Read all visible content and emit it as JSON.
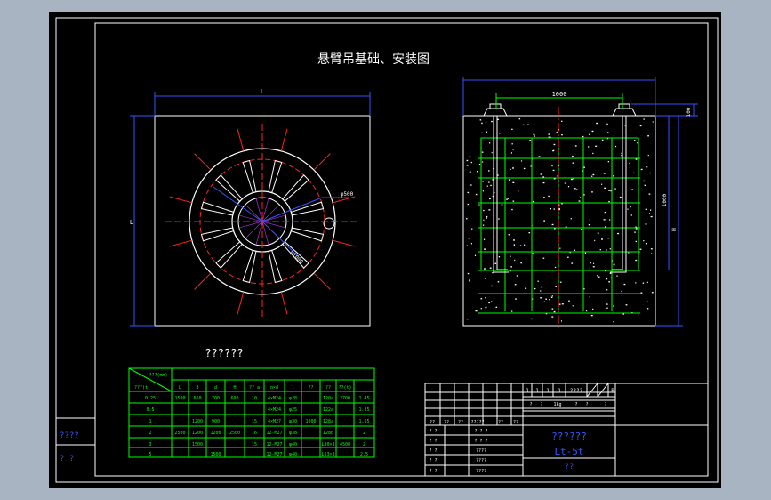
{
  "drawing_title": "悬臂吊基础、安装图",
  "table_title": "??????",
  "dimension_labels": {
    "top_width": "L",
    "left_height": "L",
    "bolt_circle": "φ500",
    "circle_dim": "φ1000",
    "section_width": "1000",
    "section_top_offset": "100",
    "section_height_a": "1000",
    "section_height_b": "H"
  },
  "spec_table": {
    "diag_top": "???(mm)",
    "diag_bottom": "???(t)",
    "headers": [
      "L",
      "B",
      "d",
      "H",
      "?? a",
      "n×d",
      "l",
      "??",
      "??",
      "??(t)"
    ],
    "loads": [
      "0.25",
      "0.5",
      "1",
      "2",
      "3",
      "5"
    ],
    "cells": [
      "1500",
      "660",
      "700",
      "600",
      "10",
      "4×M24",
      "",
      "",
      "",
      "1000",
      "900",
      "15",
      "4×M27",
      "",
      "",
      "",
      "2500",
      "1200",
      "1200",
      "2500",
      "16",
      "12-M27",
      "1000",
      "",
      "",
      "1500",
      "1500",
      "",
      "15",
      "",
      "",
      "",
      "",
      "",
      "φ28",
      "φ25",
      "φ30",
      "φ38",
      "φ40",
      "φ40",
      "I20a",
      "I22a",
      "I28a",
      "I28b",
      "L80×8",
      "L63×8",
      "2700",
      "4500",
      "1.45",
      "1.35",
      "1.65",
      "2",
      "2.5"
    ]
  },
  "spec_rows": [
    [
      "0.25",
      "1500",
      "660",
      "700",
      "600",
      "10",
      "4×M24",
      "φ28",
      "",
      "I20a",
      "2700",
      "1.45"
    ],
    [
      "0.5",
      "",
      "",
      "",
      "",
      "",
      "4×M24",
      "φ25",
      "",
      "I22a",
      "",
      "1.35"
    ],
    [
      "1",
      "",
      "1200",
      "900",
      "",
      "15",
      "4×M27",
      "φ30",
      "1000",
      "I28a",
      "",
      "1.65"
    ],
    [
      "2",
      "2500",
      "1200",
      "1200",
      "2500",
      "16",
      "12-M27",
      "φ38",
      "",
      "I28b",
      "",
      "2"
    ],
    [
      "3",
      "",
      "1500",
      "",
      "",
      "15",
      "12-M27",
      "φ40",
      "",
      "L80×8",
      "4500",
      "2"
    ],
    [
      "5",
      "",
      "",
      "1500",
      "",
      "",
      "12-M27",
      "φ40",
      "",
      "L63×8",
      "",
      "2.5"
    ]
  ],
  "title_block": {
    "row1": [
      "1",
      "1",
      "1",
      "1",
      "????",
      "",
      "B"
    ],
    "row2": [
      "?",
      "?",
      "1kg",
      "?",
      "?",
      "?"
    ],
    "row3": [
      "??",
      "??",
      "??",
      "?????",
      "??",
      "??"
    ],
    "name": "??????",
    "model": "Lt-5t",
    "sheet": "??",
    "left_rows": [
      "? ?",
      "? ?",
      "? ?",
      "? ?",
      "? ?"
    ],
    "left_values": [
      "? ? ?",
      "? ? ?",
      "????",
      "????",
      "????"
    ]
  },
  "margin_labels": [
    "????",
    "? ?"
  ],
  "colors": {
    "background": "#000000",
    "frame": "#ffffff",
    "inner_frame": "#00ffff",
    "dimension": "#3355ff",
    "centerline": "#ff2222",
    "rebar": "#00ff00",
    "table": "#00ff00",
    "text": "#ffffff"
  }
}
